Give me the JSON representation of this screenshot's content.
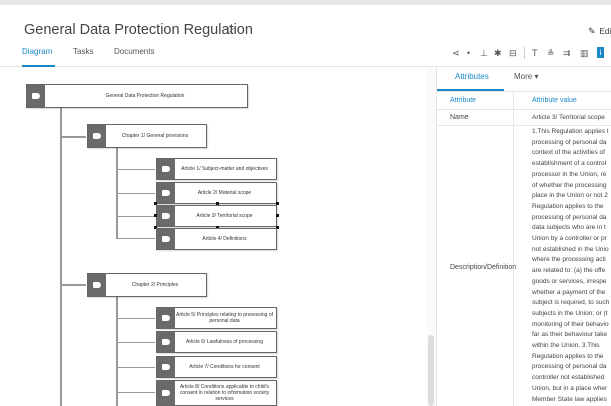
{
  "header": {
    "title": "General Data Protection Regulation",
    "star_glyph": "☆",
    "edit_label": "Edi",
    "edit_icon": "pencil-icon"
  },
  "tabs": [
    {
      "label": "Diagram",
      "active": true
    },
    {
      "label": "Tasks",
      "active": false
    },
    {
      "label": "Documents",
      "active": false
    }
  ],
  "toolbar": {
    "icons": [
      "share-icon",
      "pin-icon",
      "download-icon",
      "settings-icon",
      "print-icon",
      "text-format-icon",
      "org-chart-icon",
      "flow-icon",
      "bar-chart-icon",
      "info-icon"
    ],
    "info_glyph": "i"
  },
  "diagram": {
    "root": "General Data Protection Regulation",
    "chapters": [
      {
        "label": "Chapter 1/ General provisions",
        "articles": [
          "Article 1/ Subject-matter and objectives",
          "Article 2/ Material scope",
          "Article 3/ Territorial scope",
          "Article 4/ Definitions"
        ]
      },
      {
        "label": "Chapter 2/ Principles",
        "articles": [
          "Article 5/ Principles relating to processing of personal data",
          "Article 6/ Lawfulness of processing",
          "Article 7/ Conditions for consent",
          "Article 8/ Conditions applicable to child's consent in relation to information society services"
        ]
      }
    ]
  },
  "panel": {
    "tabs": [
      {
        "label": "Attributes",
        "active": true
      },
      {
        "label": "More ▾",
        "active": false
      }
    ],
    "columns": {
      "attribute": "Attribute",
      "value": "Attribute value"
    },
    "rows": [
      {
        "name": "Name",
        "value_lines": [
          "Article 3/ Territorial scope"
        ]
      },
      {
        "name": "Description/Definition",
        "value_lines": [
          "1.This Regulation applies t",
          "processing of personal da",
          "context of the activities of",
          "establishment of a control",
          "processor in the Union, re",
          "of whether the processing",
          "place in the Union or not 2",
          "Regulation applies to the",
          "processing of personal da",
          "data subjects who are in t",
          "Union by a controller or pr",
          "not established in the Unio",
          "where the processing acti",
          "are related to: (a) the offe",
          "goods or services, irrespe",
          "whether a payment of the",
          "subject is required, to such",
          "subjects in the Union; or (t",
          "monitoring of their behavio",
          "far as their behaviour take",
          "within the Union. 3.This",
          "Regulation applies to the",
          "processing of personal da",
          "controller not established",
          "Union, but in a place wher",
          "Member State law applies"
        ]
      }
    ]
  },
  "colors": {
    "accent": "#1a87c9",
    "tag_gray": "#6a6a6a",
    "connector": "#999999"
  }
}
